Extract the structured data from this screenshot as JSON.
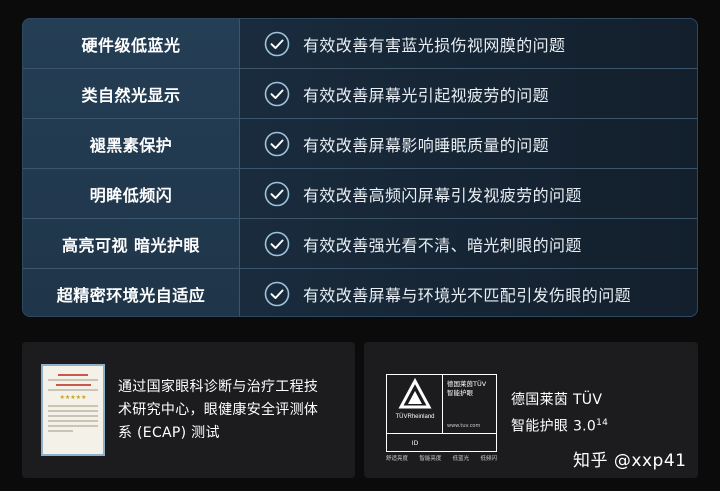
{
  "features": [
    {
      "name": "硬件级低蓝光",
      "desc": "有效改善有害蓝光损伤视网膜的问题"
    },
    {
      "name": "类自然光显示",
      "desc": "有效改善屏幕光引起视疲劳的问题"
    },
    {
      "name": "褪黑素保护",
      "desc": "有效改善屏幕影响睡眠质量的问题"
    },
    {
      "name": "明眸低频闪",
      "desc": "有效改善高频闪屏幕引发视疲劳的问题"
    },
    {
      "name": "高亮可视 暗光护眼",
      "desc": "有效改善强光看不清、暗光刺眼的问题"
    },
    {
      "name": "超精密环境光自适应",
      "desc": "有效改善屏幕与环境光不匹配引发伤眼的问题"
    }
  ],
  "icons": {
    "check": "check-circle-icon",
    "certificate": "certificate-document-icon",
    "tuv": "tuv-rheinland-logo"
  },
  "colors": {
    "check_stroke": "#9fc3dc",
    "background": "#0b0b0c",
    "card": "#1c1c1e"
  },
  "certs": {
    "ecap": {
      "line1": "通过国家眼科诊断与治疗工程技",
      "line2": "术研究中心，眼健康安全评测体",
      "line3": "系 (ECAP) 测试"
    },
    "tuv": {
      "line1": "德国莱茵 TÜV",
      "line2_main": "智能护眼 3.0",
      "line2_sup": "14",
      "logo_brand": "TÜVRheinland",
      "logo_line1": "德国莱茵TÜV",
      "logo_line2": "智能护眼",
      "logo_url": "www.tuv.com",
      "logo_id": "ID",
      "logo_strip": [
        "舒适亮度",
        "智能亮度",
        "低蓝光",
        "低频闪"
      ]
    }
  },
  "watermark": "知乎 @xxp41"
}
